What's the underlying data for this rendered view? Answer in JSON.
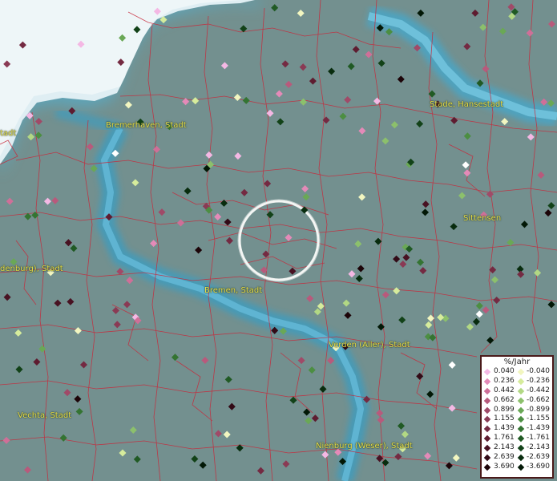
{
  "map": {
    "labels": [
      {
        "text": "Bremerhaven, Stadt",
        "name": "label-bremerhaven"
      },
      {
        "text": "Stade, Hansestadt",
        "name": "label-stade"
      },
      {
        "text": "Sittensen",
        "name": "label-sittensen"
      },
      {
        "text": "denburg), Stadt",
        "name": "label-oldenburg"
      },
      {
        "text": "Bremen, Stadt",
        "name": "label-bremen"
      },
      {
        "text": "Verden (Aller), Stadt",
        "name": "label-verden"
      },
      {
        "text": "Vechta, Stadt",
        "name": "label-vechta"
      },
      {
        "text": "Nienburg (Weser), Stadt",
        "name": "label-nienburg"
      },
      {
        "text": "tadt",
        "name": "label-edge-stadt"
      }
    ]
  },
  "legend": {
    "title": "%/Jahr",
    "positive": [
      {
        "value": "0.040",
        "color": "#f4b8e4"
      },
      {
        "value": "0.236",
        "color": "#e48ab8"
      },
      {
        "value": "0.442",
        "color": "#cf6f98"
      },
      {
        "value": "0.662",
        "color": "#b85a7c"
      },
      {
        "value": "0.899",
        "color": "#a04a68"
      },
      {
        "value": "1.155",
        "color": "#8a3a54"
      },
      {
        "value": "1.439",
        "color": "#742a42"
      },
      {
        "value": "1.761",
        "color": "#5e1c30"
      },
      {
        "value": "2.143",
        "color": "#481222"
      },
      {
        "value": "2.639",
        "color": "#320a16"
      },
      {
        "value": "3.690",
        "color": "#1c0408"
      }
    ],
    "negative": [
      {
        "value": "-0.040",
        "color": "#f2f6c0"
      },
      {
        "value": "-0.236",
        "color": "#d6ec9c"
      },
      {
        "value": "-0.442",
        "color": "#b2d884"
      },
      {
        "value": "-0.662",
        "color": "#8cc06c"
      },
      {
        "value": "-0.899",
        "color": "#6aa856"
      },
      {
        "value": "-1.155",
        "color": "#4c8e42"
      },
      {
        "value": "-1.439",
        "color": "#347432"
      },
      {
        "value": "-1.761",
        "color": "#205a24"
      },
      {
        "value": "-2.143",
        "color": "#124218"
      },
      {
        "value": "-2.639",
        "color": "#082c0e"
      },
      {
        "value": "-3.690",
        "color": "#021806"
      }
    ]
  }
}
